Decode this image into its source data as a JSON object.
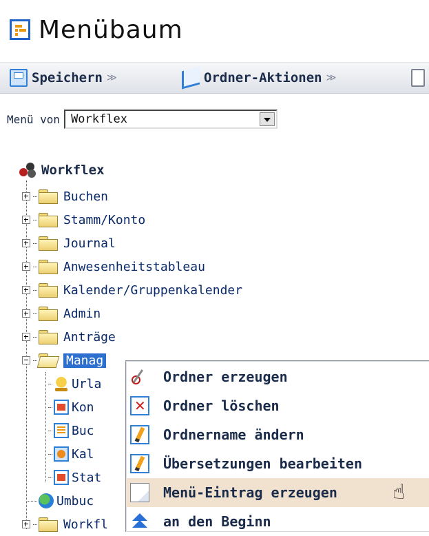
{
  "title": "Menübaum",
  "toolbar": {
    "save_label": "Speichern",
    "folder_actions_label": "Ordner-Aktionen",
    "chevron": "≫"
  },
  "menu_von": {
    "label": "Menü von",
    "selected": "Workflex"
  },
  "tree": {
    "root": "Workflex",
    "folders": [
      "Buchen",
      "Stamm/Konto",
      "Journal",
      "Anwesenheitstableau",
      "Kalender/Gruppenkalender",
      "Admin",
      "Anträge"
    ],
    "selected_folder": "Manag",
    "children": [
      "Urla",
      "Kon",
      "Buc",
      "Kal",
      "Stat"
    ],
    "after": [
      "Umbuc",
      "Workfl"
    ]
  },
  "context_menu": {
    "items": [
      "Ordner erzeugen",
      "Ordner löschen",
      "Ordnername ändern",
      "Übersetzungen bearbeiten",
      "Menü-Eintrag erzeugen",
      "an den Beginn"
    ],
    "icons": [
      "scissors-icon",
      "delete-icon",
      "pencil-icon",
      "pencil-icon",
      "page-icon",
      "up-arrow-icon"
    ],
    "hovered_index": 4
  }
}
